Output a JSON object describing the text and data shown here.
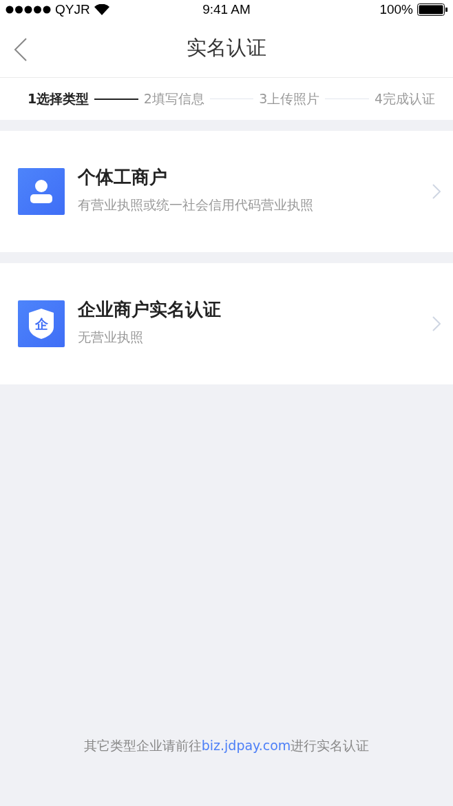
{
  "status_bar": {
    "carrier": "QYJR",
    "time": "9:41 AM",
    "battery": "100%"
  },
  "nav": {
    "title": "实名认证"
  },
  "steps": [
    {
      "label": "1选择类型",
      "selected": true
    },
    {
      "label": "2填写信息",
      "selected": false
    },
    {
      "label": "3上传照片",
      "selected": false
    },
    {
      "label": "4完成认证",
      "selected": false
    }
  ],
  "options": [
    {
      "kind": "person",
      "title": "个体工商户",
      "subtitle": "有营业执照或统一社会信用代码营业执照"
    },
    {
      "kind": "shield",
      "badge": "企",
      "title": "企业商户实名认证",
      "subtitle": "无营业执照"
    }
  ],
  "footer": {
    "before": "其它类型企业请前往",
    "link": "biz.jdpay.com",
    "after": "进行实名认证"
  }
}
